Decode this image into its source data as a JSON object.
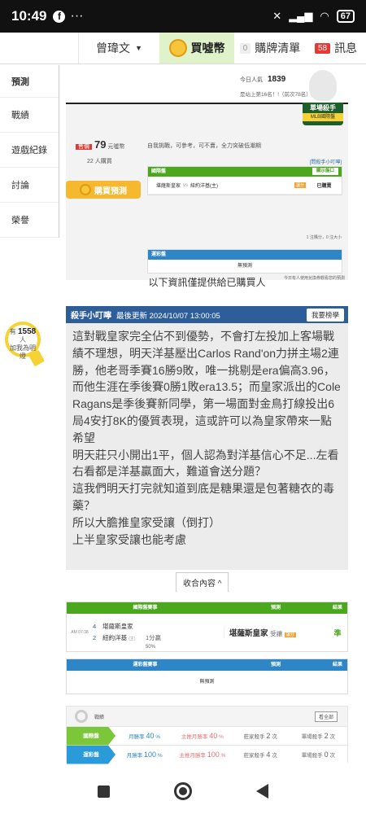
{
  "status": {
    "time": "10:49",
    "battery": "67"
  },
  "topbar": {
    "user": "曾瑋文",
    "buy": "買噓幣",
    "cart_count": "0",
    "cart": "購牌清單",
    "msg_count": "58",
    "msg": "訊息"
  },
  "sidebar": {
    "items": [
      "預測",
      "戰績",
      "遊戲紀錄",
      "討論",
      "榮譽"
    ],
    "help_prefix": "有",
    "help_count": "1558",
    "help_suffix": "人",
    "help_text": "加我為明燈"
  },
  "header": {
    "popularity_label": "今日人氣",
    "popularity": "1839",
    "rank_text": "是站上第16名！!（前次78名）"
  },
  "card": {
    "badge": "單場殺手",
    "badge_sub": "MLB國際盤",
    "sell_label": "售價",
    "price": "79",
    "price_unit": "元噓幣",
    "buyers": "22 人購買",
    "buy_button": "購買預測",
    "slogan": "自我挑戰，可參考，可不賣，全力突破低潮期",
    "helper_link": "[問殺手小叮嚀]",
    "intl": "國際盤",
    "show_btn": "顯示盤口",
    "match_home": "堪薩斯皇家",
    "match_sep": "vs",
    "match_away": "紐約洋基(主)",
    "tag": "讓分",
    "bought": "已購賣",
    "note": "1 注購分，0 注大小",
    "lottery": "運彩盤",
    "no_pred": "無預測",
    "footnote": "今日有人使用兌換券觀看您的預測"
  },
  "paid_note": "以下資訊僅提供給已購買人",
  "tips": {
    "title": "殺手小叮嚀",
    "updated": "最後更新 2024/10/07 13:00:05",
    "rank_btn": "我要榜學",
    "body": "這對戰皇家完全佔不到優勢，不會打左投加上客場戰績不理想，明天洋基壓出Carlos Rand'on力拼主場2連勝，他老哥季賽16勝9敗，唯一挑剔是era偏高3.96，而他生涯在季後賽0勝1敗era13.5；而皇家派出的Cole Ragans是季後賽新同學，第一場面對金鳥打線投出6局4安打8K的優質表現，這或許可以為皇家帶來一點希望\n明天莊只小開出1平，個人認為對洋基信心不足...左看右看都是洋基贏面大，難道會送分題？\n這我們明天打完就知道到底是糖果還是包著糖衣的毒藥？\n所以大膽推皇家受讓（倒打）\n上半皇家受讓也能考慮",
    "collapse": "收合內容 ^"
  },
  "table1": {
    "head_match": "國際盤賽事",
    "head_pred": "預測",
    "head_result": "結果",
    "time": "AM 07:38",
    "team1_no": "4",
    "team1": "堪薩斯皇家",
    "team2_no": "2",
    "team2": "紐約洋基",
    "team2_tag": "(主)",
    "handicap": "1分贏",
    "handicap_pct": "50%",
    "pred_team": "堪薩斯皇家",
    "pred_type": "受讓",
    "pred_tag": "讓分",
    "result": "準"
  },
  "table2": {
    "head_match": "運彩盤賽事",
    "head_pred": "預測",
    "head_result": "結果",
    "no_pred": "無預測"
  },
  "stats": {
    "title": "戰績",
    "more": "看全部",
    "rows": [
      {
        "label": "國際盤",
        "color": "#7cc63a",
        "c1": "月勝率",
        "v1": "40",
        "u1": "%",
        "c2": "主推月勝率",
        "v2": "40",
        "u2": "%",
        "c3": "莊家殺手",
        "v3": "2",
        "u3": "次",
        "c4": "單場殺手",
        "v4": "2",
        "u4": "次"
      },
      {
        "label": "運彩盤",
        "color": "#2a9ad8",
        "c1": "月勝率",
        "v1": "100",
        "u1": "%",
        "c2": "主推月勝率",
        "v2": "100",
        "u2": "%",
        "c3": "莊家殺手",
        "v3": "4",
        "u3": "次",
        "c4": "單場殺手",
        "v4": "0",
        "u4": "次"
      }
    ]
  }
}
